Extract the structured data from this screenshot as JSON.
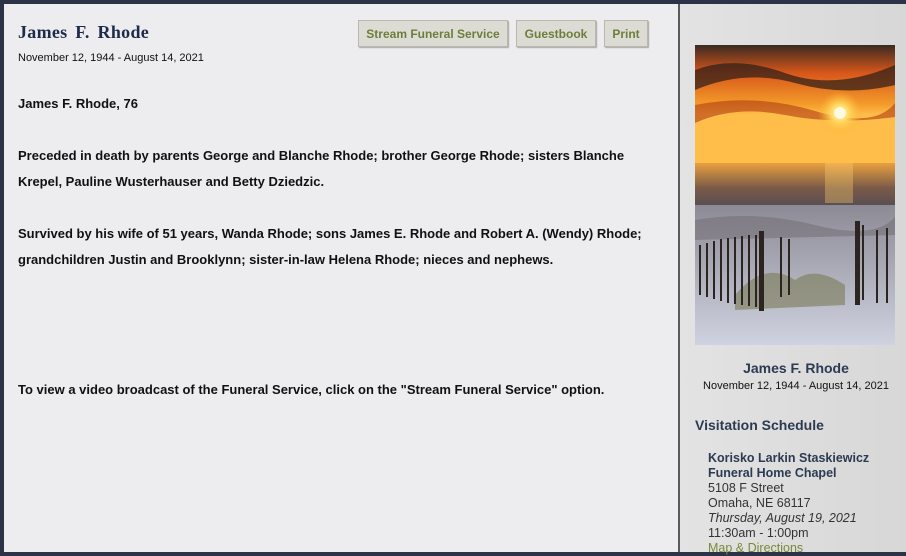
{
  "header": {
    "name": "James  F.  Rhode",
    "dates": "November 12, 1944 -  August 14, 2021"
  },
  "buttons": {
    "stream": "Stream Funeral Service",
    "guestbook": "Guestbook",
    "print": "Print"
  },
  "obituary": {
    "p1": "James F. Rhode, 76",
    "p2": "Preceded in death by parents George and Blanche Rhode; brother George Rhode; sisters Blanche Krepel, Pauline Wusterhauser and Betty Dziedzic.",
    "p3": "Survived by his wife of 51 years, Wanda Rhode; sons James E. Rhode and Robert A. (Wendy) Rhode; grandchildren Justin and Brooklynn; sister-in-law Helena Rhode; nieces and nephews.",
    "p4": "To view a video broadcast of the Funeral Service, click on the \"Stream Funeral Service\" option."
  },
  "sidebar": {
    "name": "James F. Rhode",
    "dates": "November 12, 1944 - August 14, 2021",
    "visitation_title": "Visitation Schedule",
    "venue": {
      "line1": "Korisko Larkin Staskiewicz",
      "line2": "Funeral Home Chapel",
      "street": "5108 F Street",
      "city": "Omaha, NE  68117",
      "date": "Thursday, August 19, 2021",
      "time": "11:30am - 1:00pm",
      "map_link": "Map & Directions"
    }
  },
  "colors": {
    "accent_button_text": "#6d7d3b",
    "heading": "#2c3a52"
  }
}
